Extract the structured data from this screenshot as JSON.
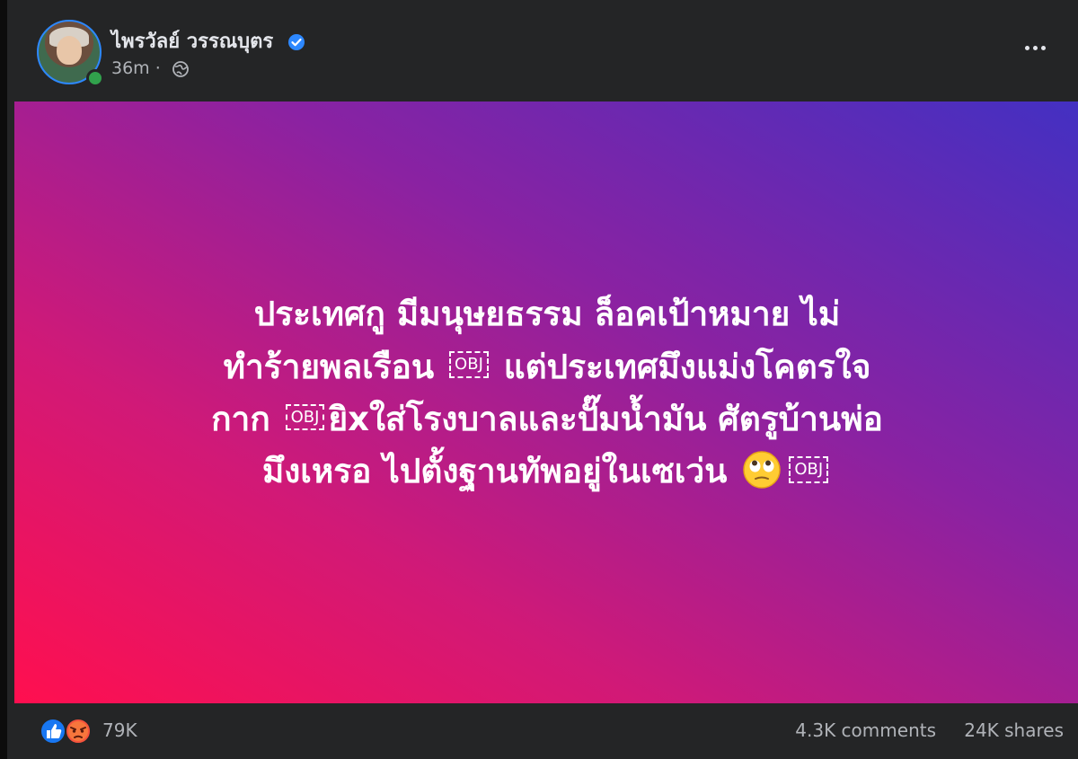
{
  "post": {
    "author": "ไพรวัลย์ วรรณบุตร",
    "time": "36m",
    "separator": "·",
    "privacy_icon": "globe-icon",
    "verified_icon": "verified-badge-icon",
    "text_lines": [
      {
        "parts": [
          "ประเทศกู มีมนุษยธรรม ล็อคเป้าหมาย ไม่"
        ]
      },
      {
        "parts": [
          "ทำร้ายพลเรือน ",
          " แต่ประเทศมึงแม่งโคตรใจ"
        ]
      },
      {
        "parts": [
          "กาก ",
          "ยิxใส่โรงบาลและปั๊มน้ำมัน ศัตรูบ้านพ่อ"
        ]
      },
      {
        "parts": [
          "มึงเหรอ ไปตั้งฐานทัพอยู่ในเซเว่น ",
          " "
        ]
      }
    ],
    "obj_placeholder": "OBJ",
    "emoji": "face-with-rolling-eyes",
    "background_gradient": [
      "#ff0f4f",
      "#d11977",
      "#8a22a2",
      "#4330c2"
    ]
  },
  "footer": {
    "reactions_count": "79K",
    "reaction_icons": [
      "like-icon",
      "angry-icon"
    ],
    "comments": "4.3K comments",
    "shares": "24K shares"
  },
  "colors": {
    "card_bg": "#242526",
    "text_primary": "#e4e6eb",
    "text_secondary": "#b0b3b8",
    "accent_blue": "#2d88ff",
    "online_green": "#31a24c"
  }
}
